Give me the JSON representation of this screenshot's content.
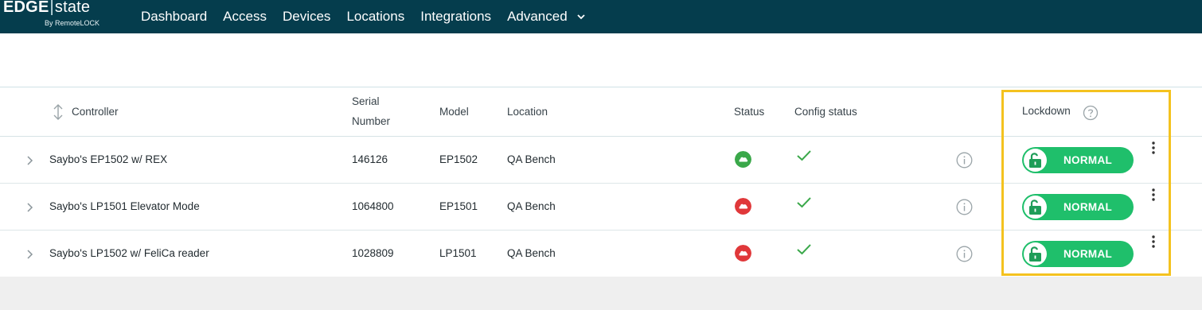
{
  "brand": {
    "name_bold": "EDGE",
    "name_light": "state",
    "tagline": "By RemoteLOCK"
  },
  "nav": {
    "items": [
      "Dashboard",
      "Access",
      "Devices",
      "Locations",
      "Integrations"
    ],
    "advanced_label": "Advanced"
  },
  "table": {
    "headers": {
      "controller": "Controller",
      "serial_line1": "Serial",
      "serial_line2": "Number",
      "model": "Model",
      "location": "Location",
      "status": "Status",
      "config_status": "Config status",
      "lockdown": "Lockdown"
    },
    "rows": [
      {
        "controller": "Saybo's EP1502 w/ REX",
        "serial": "146126",
        "model": "EP1502",
        "location": "QA Bench",
        "status": "online",
        "config_ok": true,
        "lockdown": "NORMAL"
      },
      {
        "controller": "Saybo's LP1501 Elevator Mode",
        "serial": "1064800",
        "model": "EP1501",
        "location": "QA Bench",
        "status": "offline",
        "config_ok": true,
        "lockdown": "NORMAL"
      },
      {
        "controller": "Saybo's LP1502 w/ FeliCa reader",
        "serial": "1028809",
        "model": "LP1501",
        "location": "QA Bench",
        "status": "offline",
        "config_ok": true,
        "lockdown": "NORMAL"
      }
    ]
  },
  "colors": {
    "topbar": "#053d4d",
    "status_online": "#3aa84a",
    "status_offline": "#e0383a",
    "check": "#3aa84a",
    "lockdown_toggle": "#1fbf6b",
    "lock_icon": "#1e9d58",
    "highlight": "#f4c21f"
  }
}
